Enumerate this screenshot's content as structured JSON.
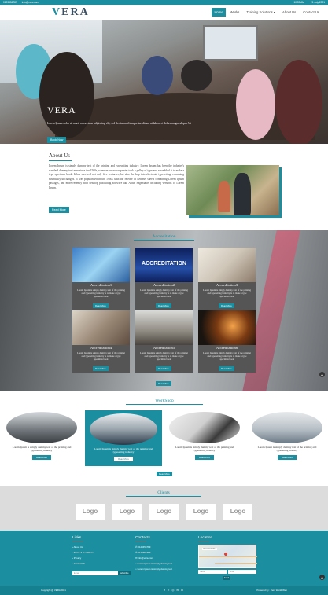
{
  "topbar": {
    "phone": "0123456789",
    "email": "info@vera.com",
    "time": "10:59 AM",
    "date": "21 July 2021"
  },
  "brand": {
    "logo_v": "V",
    "logo_rest": "ERA"
  },
  "nav": [
    {
      "label": "Home",
      "active": true
    },
    {
      "label": "Works"
    },
    {
      "label": "Training Solutions ▾"
    },
    {
      "label": "About Us"
    },
    {
      "label": "Contact Us"
    }
  ],
  "hero": {
    "title": "VERA",
    "text": "Lorem Ipsum dolor sit amet, consectetur adipiscing elit, sed do eiusmod tempor incididunt ut labore et dolore magna aliqua. Ut",
    "button": "Book Now"
  },
  "about": {
    "heading": "About Us",
    "body": "Lorem Ipsum is simply dummy text of the printing and typesetting industry. Lorem Ipsum has been the industry's standard dummy text ever since the 1500s, when an unknown printer took a galley of type and scrambled it to make a type specimen book. It has survived not only five centuries, but also the leap into electronic typesetting, remaining essentially unchanged. It was popularised in the 1960s with the release of Letraset sheets containing Lorem Ipsum passages, and more recently with desktop publishing software like Aldus PageMaker including versions of Lorem Ipsum.",
    "button": "Read More"
  },
  "accreditation": {
    "heading": "Accreditation",
    "cards": [
      {
        "title": "Accreditation1",
        "desc": "Lorem Ipsum is simply dummy text of the printing and typesetting industry is to make a type specimen book",
        "button": "Read More"
      },
      {
        "title": "Accreditation2",
        "overlay": "ACCREDITATION",
        "desc": "Lorem Ipsum is simply dummy text of the printing and typesetting industry is to make a type specimen book",
        "button": "Read More"
      },
      {
        "title": "Accreditation3",
        "desc": "Lorem Ipsum is simply dummy text of the printing and typesetting industry is to make a type specimen book",
        "button": "Read More"
      },
      {
        "title": "Accreditation4",
        "desc": "Lorem Ipsum is simply dummy text of the printing and typesetting industry is to make a type specimen book",
        "button": "Read More"
      },
      {
        "title": "Accreditation5",
        "desc": "Lorem Ipsum is simply dummy text of the printing and typesetting industry is to make a type specimen book",
        "button": "Read More"
      },
      {
        "title": "Accreditation6",
        "desc": "Lorem Ipsum is simply dummy text of the printing and typesetting industry is to make a type specimen book",
        "button": "Read More"
      }
    ],
    "more": "Read More"
  },
  "workshop": {
    "heading": "WorkShop",
    "items": [
      {
        "desc": "Lorem Ipsum is simply dummy text of the printing and typesetting industry",
        "button": "Read More"
      },
      {
        "desc": "Lorem Ipsum is simply dummy text of the printing and typesetting industry",
        "button": "Read More"
      },
      {
        "desc": "Lorem Ipsum is simply dummy text of the printing and typesetting industry",
        "button": "Read More"
      },
      {
        "desc": "Lorem Ipsum is simply dummy text of the printing and typesetting industry",
        "button": "Read More"
      }
    ],
    "more": "Read More"
  },
  "clients": {
    "heading": "Clients",
    "logos": [
      "Logo",
      "Logo",
      "Logo",
      "Logo",
      "Logo"
    ]
  },
  "footer": {
    "links_heading": "Links",
    "links": [
      "About Us",
      "Terms & Conditions",
      "Privacy",
      "Contact Us"
    ],
    "contacts_heading": "Contacts",
    "contacts": [
      "0123456789",
      "0123456789",
      "info@vera.com",
      "Lorem Ipsum is simply dummy text",
      "Lorem Ipsum is simply dummy text"
    ],
    "location_heading": "Location",
    "map_label": "Vera World Web",
    "email_placeholder": "E-mail",
    "subscribe": "Subscribe",
    "name_placeholder": "Name",
    "email2_placeholder": "Email",
    "send": "Send",
    "copyright": "Copyright @ VERA 2021",
    "powered": "Powered by : Vera World Web",
    "social": [
      "f",
      "♫",
      "◎",
      "✉",
      "in"
    ]
  },
  "colors": {
    "accent": "#1b8fa0",
    "dark_accent": "#15808f"
  }
}
